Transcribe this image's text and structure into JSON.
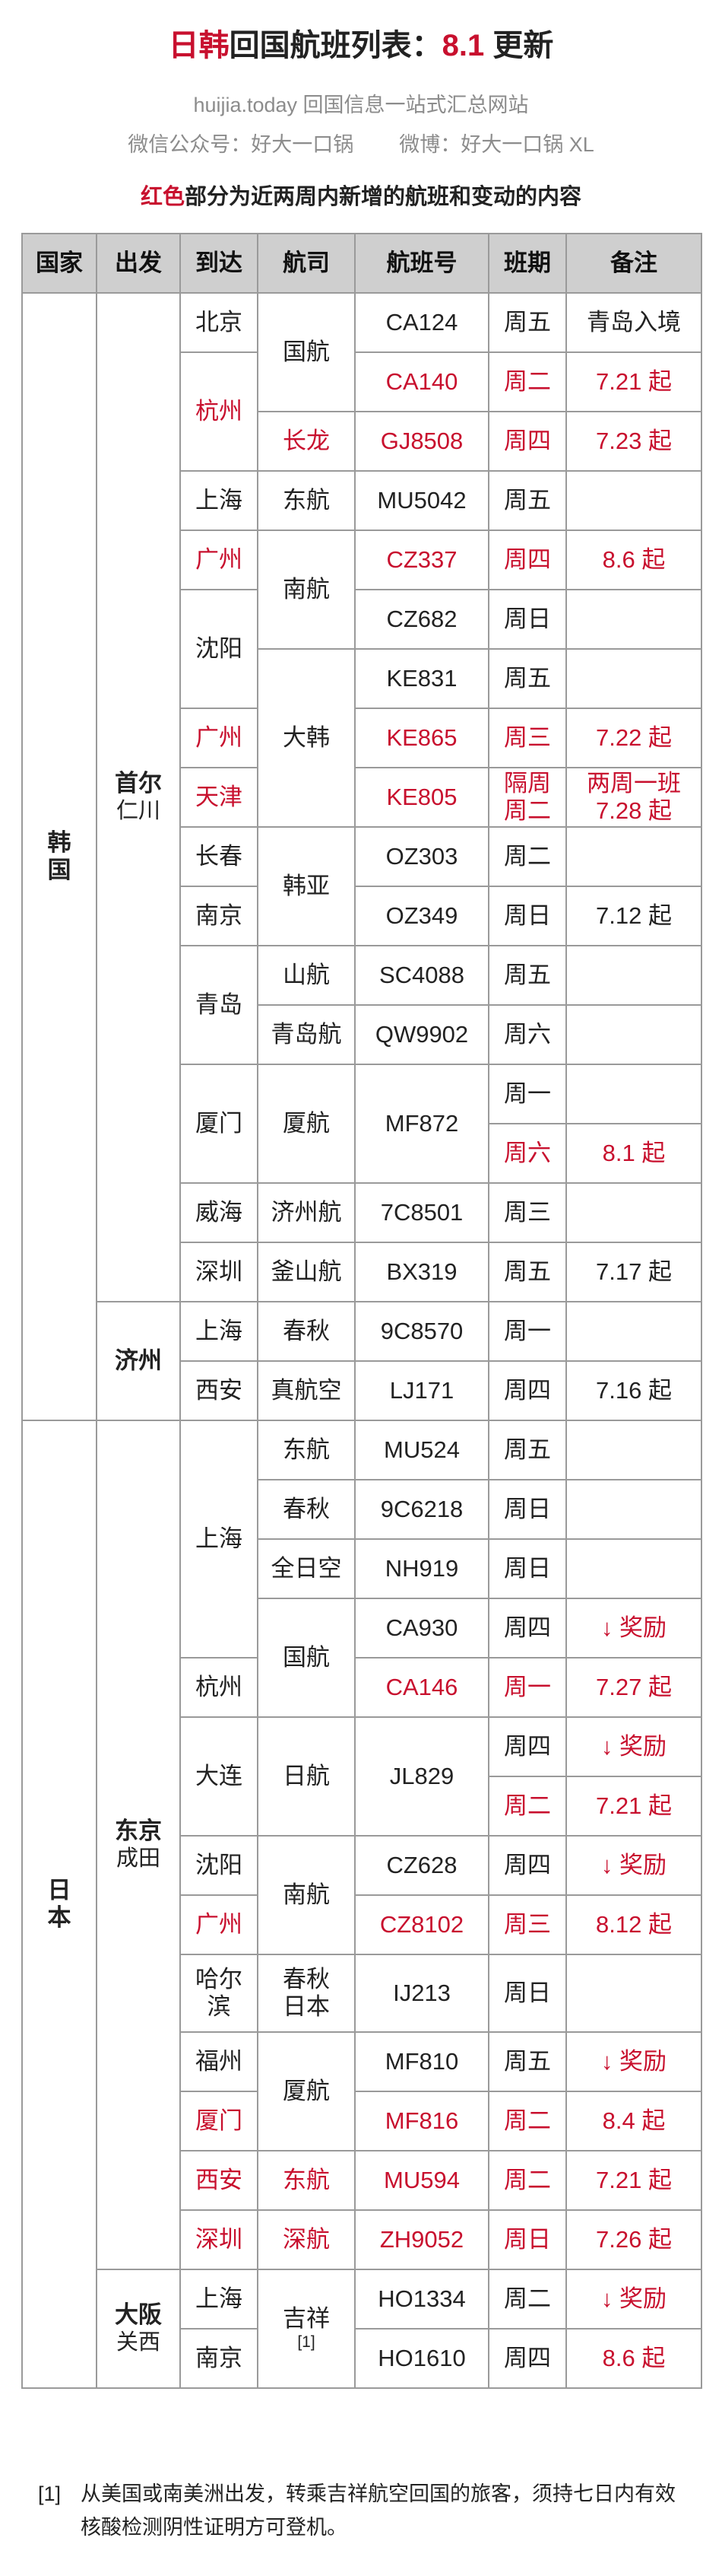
{
  "header": {
    "title_prefix": "日韩",
    "title_main": "回国航班列表：",
    "title_version": "8.1",
    "title_suffix": " 更新",
    "site_line": "huijia.today 回国信息一站式汇总网站",
    "wechat": "微信公众号：好大一口锅",
    "weibo": "微博：好大一口锅 XL",
    "note_red": "红色",
    "note_rest": "部分为近两周内新增的航班和变动的内容"
  },
  "columns": [
    "国家",
    "出发",
    "到达",
    "航司",
    "航班号",
    "班期",
    "备注"
  ],
  "countries": {
    "korea": "韩\n国",
    "japan": "日\n本"
  },
  "origins": {
    "seoul_city": "首尔",
    "seoul_airport": "仁川",
    "jinan_city": "济州",
    "tokyo_city": "东京",
    "tokyo_airport": "成田",
    "osaka_city": "大阪",
    "osaka_airport": "关西"
  },
  "rows": [
    {
      "dest": "北京",
      "airline": "国航",
      "flight": "CA124",
      "day": "周五",
      "note": "青岛入境"
    },
    {
      "dest": "杭州",
      "airline": "",
      "flight": "CA140",
      "day": "周二",
      "note": "7.21 起"
    },
    {
      "dest": "",
      "airline": "长龙",
      "flight": "GJ8508",
      "day": "周四",
      "note": "7.23 起"
    },
    {
      "dest": "上海",
      "airline": "东航",
      "flight": "MU5042",
      "day": "周五",
      "note": ""
    },
    {
      "dest": "广州",
      "airline": "南航",
      "flight": "CZ337",
      "day": "周四",
      "note": "8.6 起"
    },
    {
      "dest": "沈阳",
      "airline": "",
      "flight": "CZ682",
      "day": "周日",
      "note": ""
    },
    {
      "dest": "",
      "airline": "大韩",
      "flight": "KE831",
      "day": "周五",
      "note": ""
    },
    {
      "dest": "广州",
      "airline": "",
      "flight": "KE865",
      "day": "周三",
      "note": "7.22 起"
    },
    {
      "dest": "天津",
      "airline": "",
      "flight": "KE805",
      "day": "隔周周二",
      "note": "两周一班7.28 起"
    },
    {
      "dest": "长春",
      "airline": "韩亚",
      "flight": "OZ303",
      "day": "周二",
      "note": ""
    },
    {
      "dest": "南京",
      "airline": "",
      "flight": "OZ349",
      "day": "周日",
      "note": "7.12 起"
    },
    {
      "dest": "青岛",
      "airline": "山航",
      "flight": "SC4088",
      "day": "周五",
      "note": ""
    },
    {
      "dest": "",
      "airline": "青岛航",
      "flight": "QW9902",
      "day": "周六",
      "note": ""
    },
    {
      "dest": "厦门",
      "airline": "厦航",
      "flight": "MF872",
      "day": "周一",
      "note": ""
    },
    {
      "dest": "",
      "airline": "",
      "flight": "",
      "day": "周六",
      "note": "8.1 起"
    },
    {
      "dest": "威海",
      "airline": "济州航",
      "flight": "7C8501",
      "day": "周三",
      "note": ""
    },
    {
      "dest": "深圳",
      "airline": "釜山航",
      "flight": "BX319",
      "day": "周五",
      "note": "7.17 起"
    },
    {
      "dest": "上海",
      "airline": "春秋",
      "flight": "9C8570",
      "day": "周一",
      "note": ""
    },
    {
      "dest": "西安",
      "airline": "真航空",
      "flight": "LJ171",
      "day": "周四",
      "note": "7.16 起"
    },
    {
      "dest": "上海",
      "airline": "东航",
      "flight": "MU524",
      "day": "周五",
      "note": ""
    },
    {
      "dest": "",
      "airline": "春秋",
      "flight": "9C6218",
      "day": "周日",
      "note": ""
    },
    {
      "dest": "",
      "airline": "全日空",
      "flight": "NH919",
      "day": "周日",
      "note": ""
    },
    {
      "dest": "",
      "airline": "国航",
      "flight": "CA930",
      "day": "周四",
      "note": "↓ 奖励"
    },
    {
      "dest": "杭州",
      "airline": "",
      "flight": "CA146",
      "day": "周一",
      "note": "7.27 起"
    },
    {
      "dest": "大连",
      "airline": "日航",
      "flight": "JL829",
      "day": "周四",
      "note": "↓ 奖励"
    },
    {
      "dest": "",
      "airline": "",
      "flight": "",
      "day": "周二",
      "note": "7.21 起"
    },
    {
      "dest": "沈阳",
      "airline": "南航",
      "flight": "CZ628",
      "day": "周四",
      "note": "↓ 奖励"
    },
    {
      "dest": "广州",
      "airline": "",
      "flight": "CZ8102",
      "day": "周三",
      "note": "8.12 起"
    },
    {
      "dest": "哈尔滨",
      "airline": "春秋日本",
      "flight": "IJ213",
      "day": "周日",
      "note": ""
    },
    {
      "dest": "福州",
      "airline": "厦航",
      "flight": "MF810",
      "day": "周五",
      "note": "↓ 奖励"
    },
    {
      "dest": "厦门",
      "airline": "",
      "flight": "MF816",
      "day": "周二",
      "note": "8.4 起"
    },
    {
      "dest": "西安",
      "airline": "东航",
      "flight": "MU594",
      "day": "周二",
      "note": "7.21 起"
    },
    {
      "dest": "深圳",
      "airline": "深航",
      "flight": "ZH9052",
      "day": "周日",
      "note": "7.26 起"
    },
    {
      "dest": "上海",
      "airline": "吉祥",
      "flight": "HO1334",
      "day": "周二",
      "note": "↓ 奖励"
    },
    {
      "dest": "南京",
      "airline": "",
      "flight": "HO1610",
      "day": "周四",
      "note": "8.6 起"
    }
  ],
  "split": {
    "kyotsu_line1": "两周一班",
    "kyotsu_line2": "7.28 起",
    "biweekly_line1": "隔周",
    "biweekly_line2": "周二",
    "harbin_line1": "哈尔",
    "harbin_line2": "滨",
    "spring_japan_line1": "春秋",
    "spring_japan_line2": "日本",
    "juneyao_ref": "[1]"
  },
  "footnote": {
    "mark": "[1]",
    "text": "从美国或南美洲出发，转乘吉祥航空回国的旅客，须持七日内有效核酸检测阴性证明方可登机。"
  }
}
